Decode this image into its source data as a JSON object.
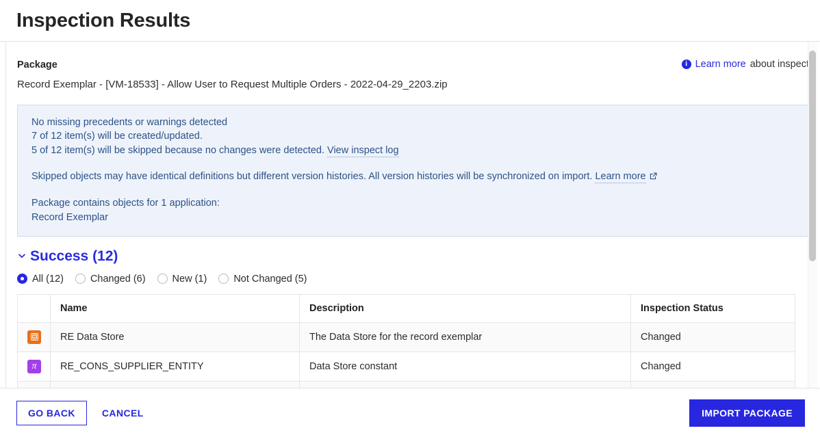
{
  "header": {
    "title": "Inspection Results"
  },
  "package": {
    "label": "Package",
    "value": "Record Exemplar - [VM-18533] - Allow User to Request Multiple Orders - 2022-04-29_2203.zip",
    "learn_more_link": "Learn more",
    "learn_more_suffix": "about inspect",
    "info_icon": "info-icon"
  },
  "message": {
    "line1": "No missing precedents or warnings detected",
    "line2": "7 of 12 item(s) will be created/updated.",
    "line3_text": "5 of 12 item(s) will be skipped because no changes were detected.",
    "line3_link": "View inspect log",
    "line4_text": "Skipped objects may have identical definitions but different version histories. All version histories will be synchronized on import.",
    "line4_link": "Learn more",
    "line5": "Package contains objects for 1 application:",
    "line6": "Record Exemplar",
    "external_icon": "external-link-icon"
  },
  "section": {
    "chevron_icon": "chevron-down-icon",
    "title": "Success (12)",
    "expanded": true
  },
  "filters": [
    {
      "label": "All (12)",
      "selected": true
    },
    {
      "label": "Changed (6)",
      "selected": false
    },
    {
      "label": "New (1)",
      "selected": false
    },
    {
      "label": "Not Changed (5)",
      "selected": false
    }
  ],
  "table": {
    "columns": [
      "",
      "Name",
      "Description",
      "Inspection Status"
    ],
    "rows": [
      {
        "icon": "datastore-icon",
        "icon_glyph": "☰",
        "name": "RE Data Store",
        "description": "The Data Store for the record exemplar",
        "status": "Changed"
      },
      {
        "icon": "constant-icon",
        "icon_glyph": "π",
        "name": "RE_CONS_SUPPLIER_ENTITY",
        "description": "Data Store constant",
        "status": "Changed"
      },
      {
        "icon": "",
        "icon_glyph": "",
        "name": "",
        "description": "",
        "status": ""
      }
    ]
  },
  "footer": {
    "go_back": "GO BACK",
    "cancel": "CANCEL",
    "import": "IMPORT PACKAGE"
  },
  "colors": {
    "accent": "#2727e0",
    "info_bg": "#eef3fb",
    "info_border": "#cfd9ec",
    "info_text": "#2d5286",
    "datastore_icon": "#e8701a",
    "constant_icon": "#a33fe8"
  }
}
